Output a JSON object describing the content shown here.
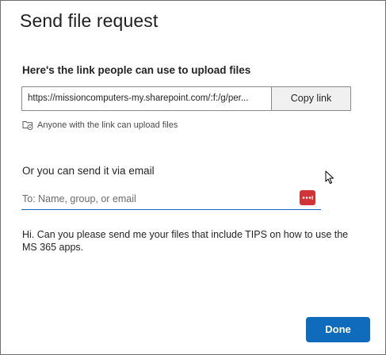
{
  "dialog": {
    "title": "Send file request",
    "link_heading": "Here's the link people can use to upload files",
    "link_url": "https://missioncomputers-my.sharepoint.com/:f:/g/per...",
    "copy_link_label": "Copy link",
    "permission_text": "Anyone with the link can upload files",
    "email_heading": "Or you can send it via email",
    "email_placeholder": "To: Name, group, or email",
    "message": "Hi. Can you please send me your files that include TIPS on how to use the MS 365 apps.",
    "done_label": "Done"
  },
  "icons": {
    "permission": "folder-link-icon",
    "password_manager": "password-manager-icon",
    "cursor": "mouse-cursor-icon"
  },
  "colors": {
    "accent": "#0f6cbd",
    "password_manager_badge": "#d13438"
  }
}
